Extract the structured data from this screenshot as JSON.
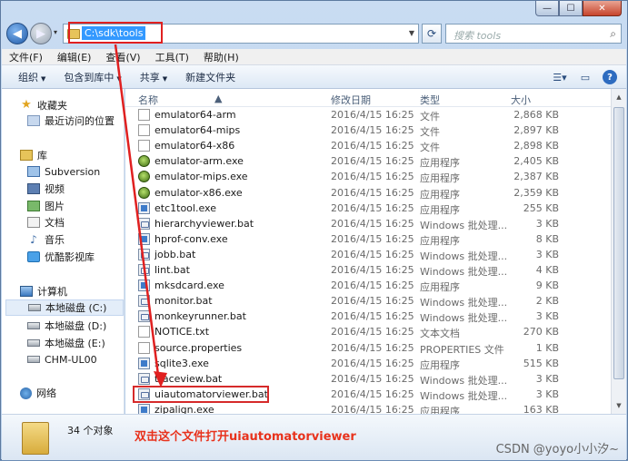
{
  "address": {
    "path": "C:\\sdk\\tools"
  },
  "search": {
    "placeholder": "搜索 tools"
  },
  "menubar": [
    "文件(F)",
    "编辑(E)",
    "查看(V)",
    "工具(T)",
    "帮助(H)"
  ],
  "commands": {
    "organize": "组织",
    "include_library": "包含到库中",
    "share": "共享",
    "new_folder": "新建文件夹"
  },
  "columns": {
    "name": "名称",
    "date": "修改日期",
    "type": "类型",
    "size": "大小"
  },
  "nav": {
    "favorites": "收藏夹",
    "recent": "最近访问的位置",
    "libraries": "库",
    "subversion": "Subversion",
    "videos": "视频",
    "pictures": "图片",
    "documents": "文档",
    "music": "音乐",
    "youku": "优酷影视库",
    "computer": "计算机",
    "drive_c": "本地磁盘 (C:)",
    "drive_d": "本地磁盘 (D:)",
    "drive_e": "本地磁盘 (E:)",
    "chm": "CHM-UL00",
    "network": "网络"
  },
  "files": [
    {
      "name": "emulator64-arm",
      "date": "2016/4/15 16:25",
      "type": "文件",
      "size": "2,868 KB",
      "icon": "file"
    },
    {
      "name": "emulator64-mips",
      "date": "2016/4/15 16:25",
      "type": "文件",
      "size": "2,897 KB",
      "icon": "file"
    },
    {
      "name": "emulator64-x86",
      "date": "2016/4/15 16:25",
      "type": "文件",
      "size": "2,898 KB",
      "icon": "file"
    },
    {
      "name": "emulator-arm.exe",
      "date": "2016/4/15 16:25",
      "type": "应用程序",
      "size": "2,405 KB",
      "icon": "droid"
    },
    {
      "name": "emulator-mips.exe",
      "date": "2016/4/15 16:25",
      "type": "应用程序",
      "size": "2,387 KB",
      "icon": "droid"
    },
    {
      "name": "emulator-x86.exe",
      "date": "2016/4/15 16:25",
      "type": "应用程序",
      "size": "2,359 KB",
      "icon": "droid"
    },
    {
      "name": "etc1tool.exe",
      "date": "2016/4/15 16:25",
      "type": "应用程序",
      "size": "255 KB",
      "icon": "exe"
    },
    {
      "name": "hierarchyviewer.bat",
      "date": "2016/4/15 16:25",
      "type": "Windows 批处理...",
      "size": "3 KB",
      "icon": "bat"
    },
    {
      "name": "hprof-conv.exe",
      "date": "2016/4/15 16:25",
      "type": "应用程序",
      "size": "8 KB",
      "icon": "exe"
    },
    {
      "name": "jobb.bat",
      "date": "2016/4/15 16:25",
      "type": "Windows 批处理...",
      "size": "3 KB",
      "icon": "bat"
    },
    {
      "name": "lint.bat",
      "date": "2016/4/15 16:25",
      "type": "Windows 批处理...",
      "size": "4 KB",
      "icon": "bat"
    },
    {
      "name": "mksdcard.exe",
      "date": "2016/4/15 16:25",
      "type": "应用程序",
      "size": "9 KB",
      "icon": "exe"
    },
    {
      "name": "monitor.bat",
      "date": "2016/4/15 16:25",
      "type": "Windows 批处理...",
      "size": "2 KB",
      "icon": "bat"
    },
    {
      "name": "monkeyrunner.bat",
      "date": "2016/4/15 16:25",
      "type": "Windows 批处理...",
      "size": "3 KB",
      "icon": "bat"
    },
    {
      "name": "NOTICE.txt",
      "date": "2016/4/15 16:25",
      "type": "文本文档",
      "size": "270 KB",
      "icon": "file"
    },
    {
      "name": "source.properties",
      "date": "2016/4/15 16:25",
      "type": "PROPERTIES 文件",
      "size": "1 KB",
      "icon": "file"
    },
    {
      "name": "sqlite3.exe",
      "date": "2016/4/15 16:25",
      "type": "应用程序",
      "size": "515 KB",
      "icon": "exe"
    },
    {
      "name": "traceview.bat",
      "date": "2016/4/15 16:25",
      "type": "Windows 批处理...",
      "size": "3 KB",
      "icon": "bat"
    },
    {
      "name": "uiautomatorviewer.bat",
      "date": "2016/4/15 16:25",
      "type": "Windows 批处理...",
      "size": "3 KB",
      "icon": "bat"
    },
    {
      "name": "zipalign.exe",
      "date": "2016/4/15 16:25",
      "type": "应用程序",
      "size": "163 KB",
      "icon": "exe"
    }
  ],
  "details": {
    "count": "34 个对象",
    "annotation": "双击这个文件打开uiautomatorviewer",
    "watermark": "CSDN @yoyo小小汐~"
  },
  "colors": {
    "annotation": "#e8321c",
    "selection": "#3399ff"
  }
}
